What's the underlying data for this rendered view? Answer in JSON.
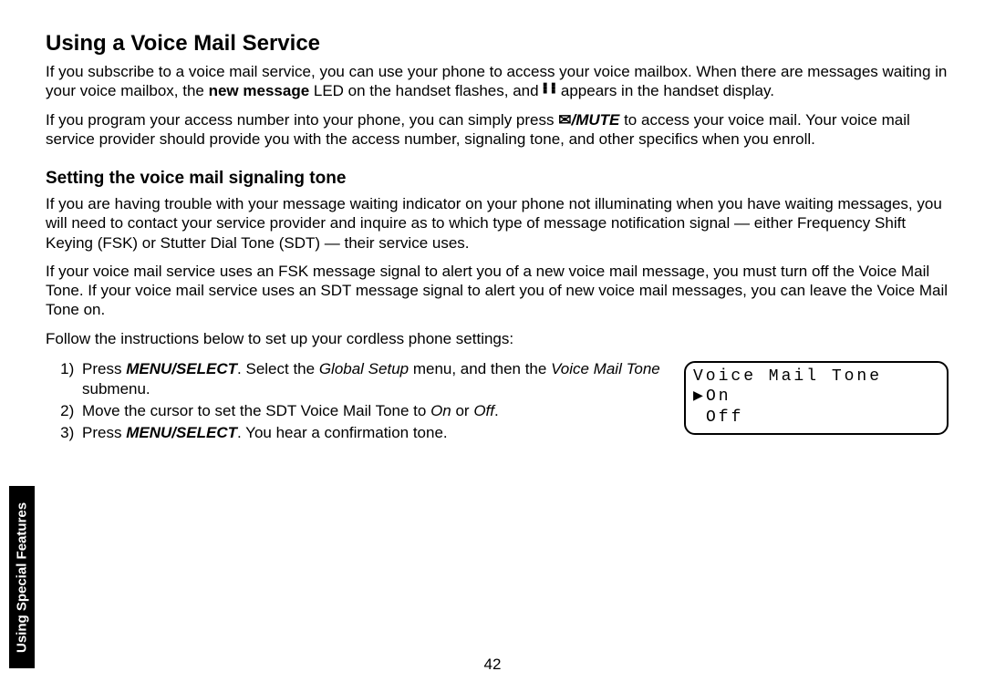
{
  "title": "Using a Voice Mail Service",
  "p1": {
    "a": "If you subscribe to a voice mail service, you can use your phone to access your voice mailbox. When there are messages waiting in your voice mailbox, the ",
    "b": "new message",
    "c": " LED on the handset flashes, and ",
    "d": " appears in the handset display."
  },
  "p2": {
    "a": "If you program your access number into your phone, you can simply press ",
    "mute": "/MUTE",
    "b": " to access your voice mail. Your voice mail service provider should provide you with the access number, signaling tone, and other specifics when you enroll."
  },
  "subheading": "Setting the voice mail signaling tone",
  "p3": "If you are having trouble with your message waiting indicator on your phone not illuminating when you have waiting messages, you will need to contact your service provider and inquire as to which type of message notification signal — either Frequency Shift Keying (FSK) or Stutter Dial Tone (SDT) — their service uses.",
  "p4": "If your voice mail service uses an FSK message signal to alert you of a new voice mail message, you must turn off the Voice Mail Tone. If your voice mail service uses an SDT message signal to alert you of new voice mail messages, you can leave the Voice Mail Tone on.",
  "p5": "Follow the instructions below to set up your cordless phone settings:",
  "steps": {
    "s1": {
      "a": "Press ",
      "b": "MENU/SELECT",
      "c": ". Select the ",
      "d": "Global Setup",
      "e": " menu, and then the ",
      "f": "Voice Mail Tone",
      "g": " submenu."
    },
    "s2": {
      "a": "Move the cursor to set the SDT Voice Mail Tone to ",
      "on": "On",
      "or": " or ",
      "off": "Off",
      "end": "."
    },
    "s3": {
      "a": "Press ",
      "b": "MENU/SELECT",
      "c": ". You hear a confirmation tone."
    }
  },
  "lcd": {
    "line1": "Voice Mail Tone",
    "cursor": "▶",
    "opt1": "On",
    "opt2": "Off"
  },
  "vm_icon_row": "■ ■",
  "side_tab": "Using Special Features",
  "page_number": "42"
}
